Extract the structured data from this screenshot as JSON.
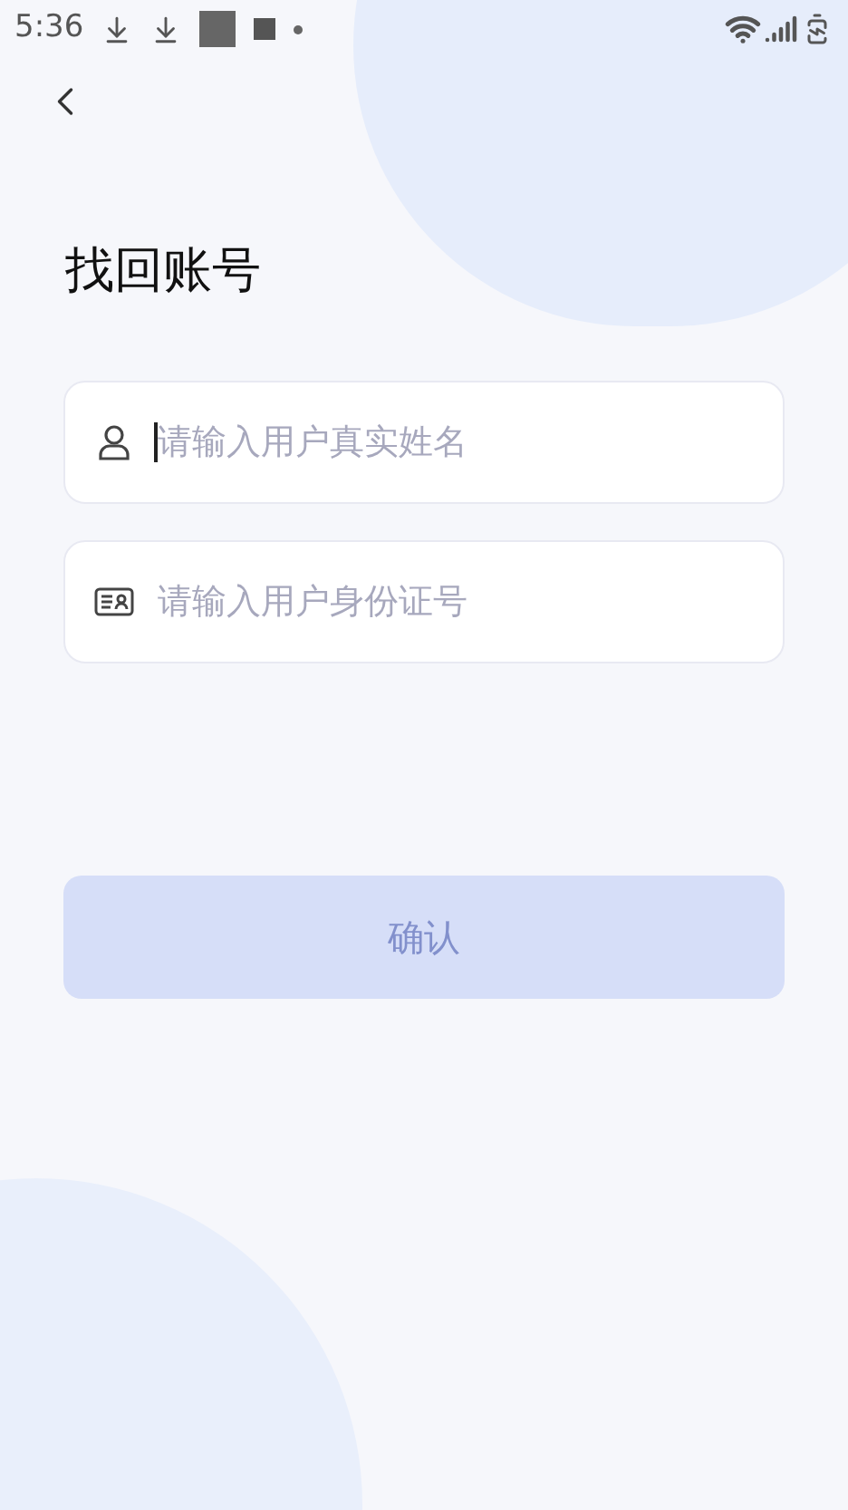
{
  "status_bar": {
    "time": "5:36"
  },
  "title": "找回账号",
  "fields": [
    {
      "kind": "person",
      "placeholder": "请输入用户真实姓名",
      "focused": true
    },
    {
      "kind": "id-card",
      "placeholder": "请输入用户身份证号",
      "focused": false
    }
  ],
  "confirm_button": {
    "label": "确认",
    "disabled": true
  }
}
